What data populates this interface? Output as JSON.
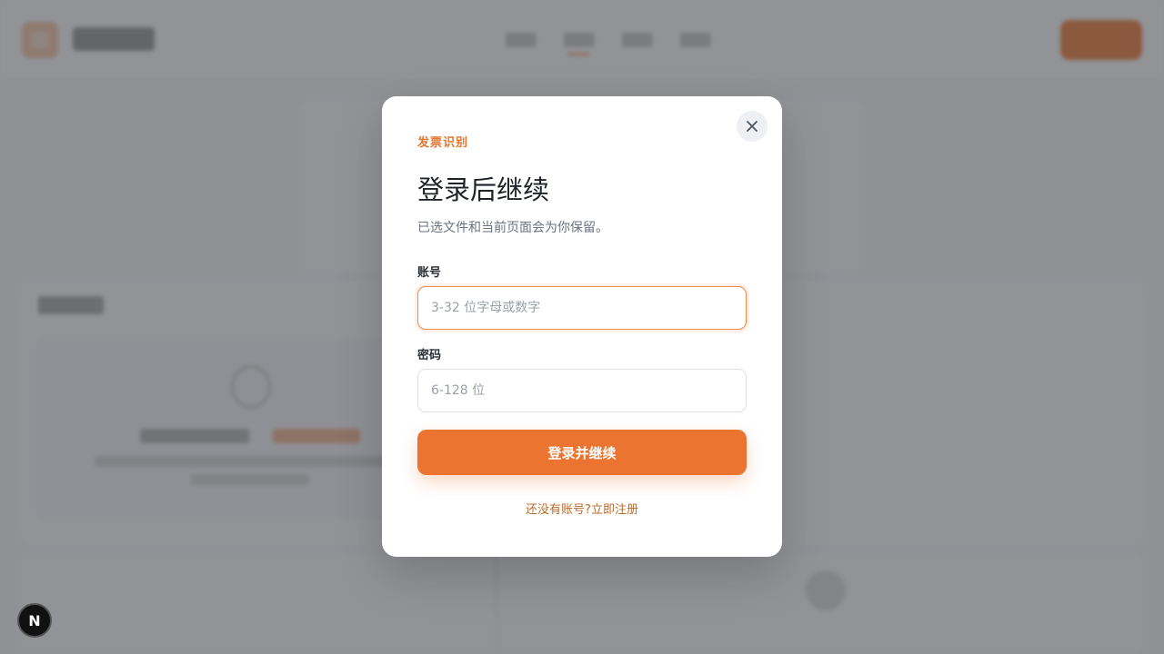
{
  "modal": {
    "eyebrow": "发票识别",
    "title": "登录后继续",
    "subtitle": "已选文件和当前页面会为你保留。",
    "close_icon": "close-icon",
    "account": {
      "label": "账号",
      "placeholder": "3-32 位字母或数字",
      "value": ""
    },
    "password": {
      "label": "密码",
      "placeholder": "6-128 位",
      "value": ""
    },
    "submit_label": "登录并继续",
    "register_prompt": "还没有账号?",
    "register_link": "立即注册"
  },
  "dev_badge": {
    "label": "N"
  },
  "colors": {
    "accent": "#ec7431",
    "eyebrow": "#e4762f",
    "link": "#b86a2a"
  }
}
